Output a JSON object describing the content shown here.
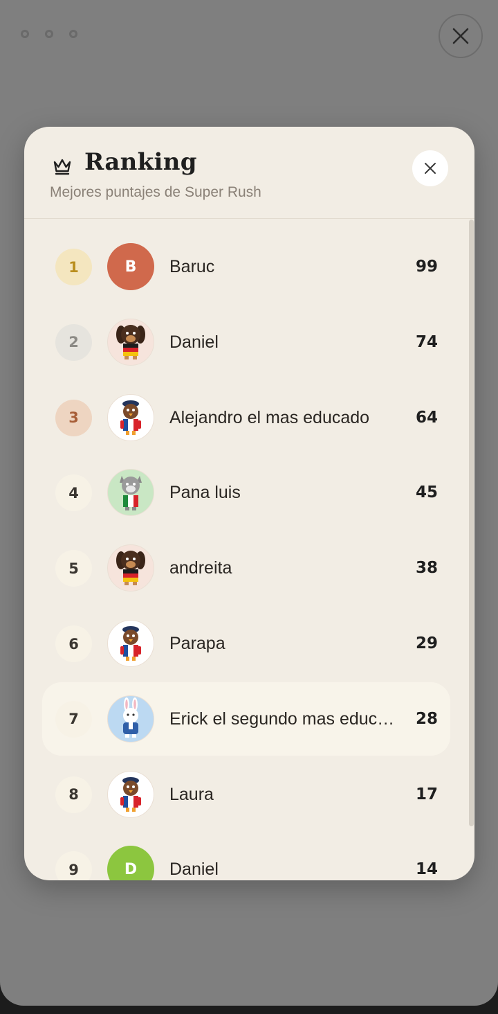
{
  "modal": {
    "title": "Ranking",
    "subtitle": "Mejores puntajes de Super Rush"
  },
  "icons": {
    "top_close": "close-icon",
    "modal_close": "close-icon",
    "crown": "crown-icon"
  },
  "colors": {
    "rank1_bg": "#f4e6bf",
    "rank1_fg": "#b98e1d",
    "rank2_bg": "#e6e4de",
    "rank2_fg": "#8c8a85",
    "rank3_bg": "#eed5c1",
    "rank3_fg": "#a75e38"
  },
  "rows": [
    {
      "rank": "1",
      "name": "Baruc",
      "score": "99",
      "avatar": {
        "type": "letter",
        "letter": "B",
        "color": "#d0694c"
      }
    },
    {
      "rank": "2",
      "name": "Daniel",
      "score": "74",
      "avatar": {
        "type": "dog-germany",
        "bg": "#f6e4dc"
      }
    },
    {
      "rank": "3",
      "name": "Alejandro el mas educado",
      "score": "64",
      "avatar": {
        "type": "bird-france",
        "bg": "#ffffff"
      }
    },
    {
      "rank": "4",
      "name": "Pana luis",
      "score": "45",
      "avatar": {
        "type": "cat-italy",
        "bg": "#c9e7c4"
      }
    },
    {
      "rank": "5",
      "name": "andreita",
      "score": "38",
      "avatar": {
        "type": "dog-germany",
        "bg": "#f6e4dc"
      }
    },
    {
      "rank": "6",
      "name": "Parapa",
      "score": "29",
      "avatar": {
        "type": "bird-france",
        "bg": "#ffffff"
      }
    },
    {
      "rank": "7",
      "name": "Erick el segundo mas educado",
      "score": "28",
      "avatar": {
        "type": "rabbit-blue",
        "bg": "#bcd9f2"
      },
      "highlight": true
    },
    {
      "rank": "8",
      "name": "Laura",
      "score": "17",
      "avatar": {
        "type": "bird-france",
        "bg": "#ffffff"
      }
    },
    {
      "rank": "9",
      "name": "Daniel",
      "score": "14",
      "avatar": {
        "type": "letter",
        "letter": "D",
        "color": "#8cc63f"
      }
    }
  ]
}
